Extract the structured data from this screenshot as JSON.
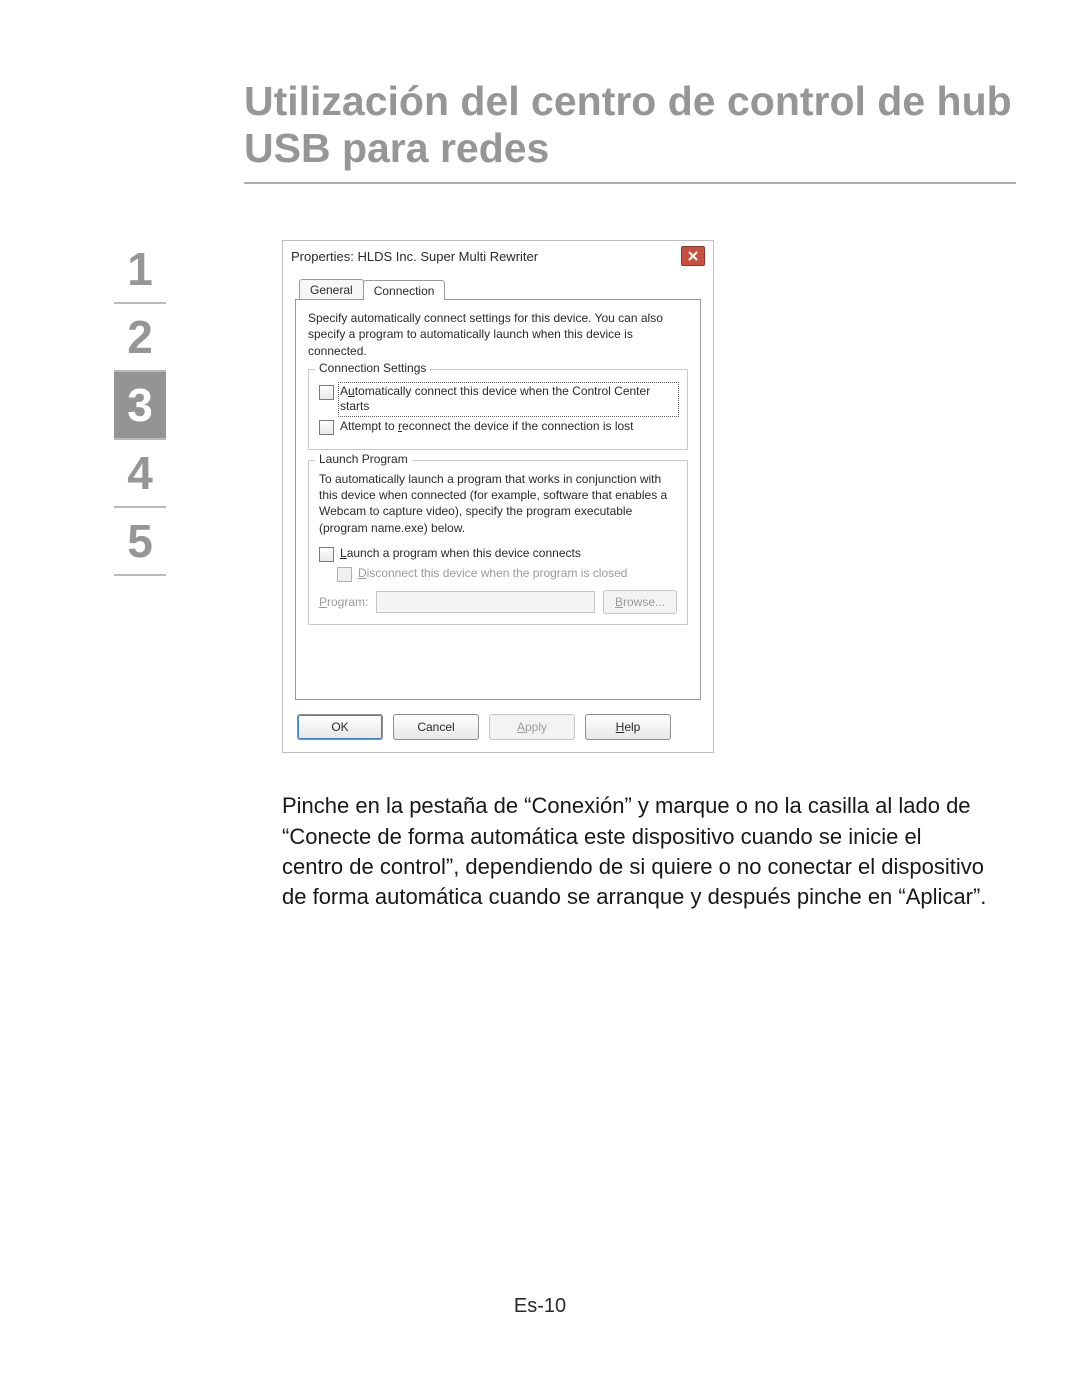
{
  "page": {
    "title": "Utilización del centro de control de hub USB para redes",
    "body_text": "Pinche en la pestaña de “Conexión” y marque o no la casilla al lado de “Conecte de forma automática este dispositivo cuando se inicie el centro de control”, dependiendo de si quiere o no conectar el dispositivo de forma automática cuando se arranque y después pinche en “Aplicar”.",
    "footer": "Es-10"
  },
  "nav": [
    "1",
    "2",
    "3",
    "4",
    "5"
  ],
  "dialog": {
    "title": "Properties: HLDS Inc. Super Multi Rewriter",
    "tabs": [
      "General",
      "Connection"
    ],
    "intro": "Specify automatically connect settings for this device. You can also specify a program to automatically launch when this device is connected.",
    "groups": {
      "connection": {
        "legend": "Connection Settings",
        "auto_connect_label": "Automatically connect this device when the Control Center starts",
        "reconnect_label": "Attempt to reconnect the device if the connection is lost"
      },
      "launch": {
        "legend": "Launch Program",
        "intro": "To automatically launch a program that works in conjunction with this device when connected (for example, software that enables a Webcam to capture video), specify the program executable (program name.exe) below.",
        "launch_label": "Launch a program when this device connects",
        "disconnect_label": "Disconnect this device when the program is closed",
        "program_label": "Program:",
        "browse": "Browse..."
      }
    },
    "buttons": {
      "ok": "OK",
      "cancel": "Cancel",
      "apply": "Apply",
      "help": "Help"
    }
  }
}
